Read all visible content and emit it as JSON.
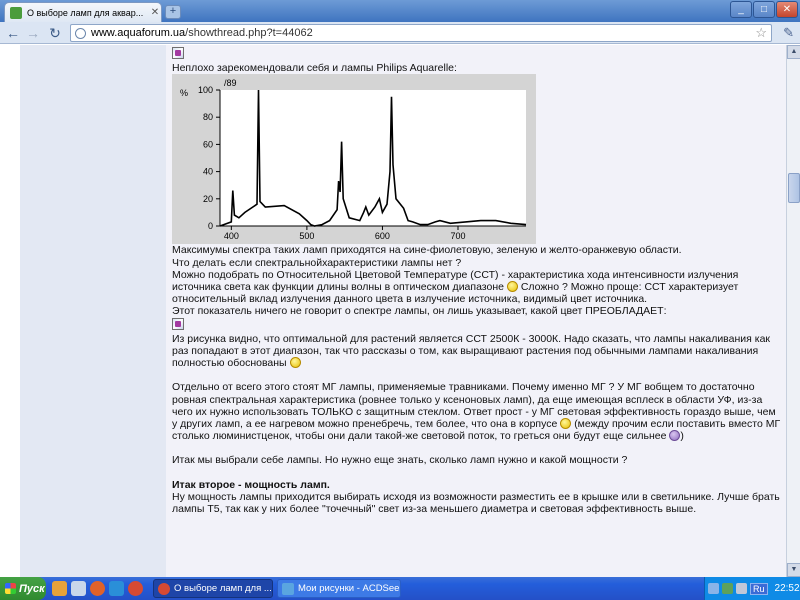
{
  "browser": {
    "tab_title": "О выборе ламп для аквар...",
    "url_domain": "www.aquaforum.ua",
    "url_path": "/showthread.php?t=44062"
  },
  "post": {
    "p1": "Неплохо зарекомендовали себя и лампы Philips Aquarelle:",
    "p2": "Максимумы спектра таких ламп приходятся на сине-фиолетовую, зеленую и желто-оранжевую области.",
    "p3": "Что делать если спектральнойхарактеристики лампы нет ?",
    "p4a": "Можно подобрать по Относительной Цветовой Температуре (ССТ) - характеристика хода интенсивности излучения источника света как функции длины волны в оптическом диапазоне",
    "p4b": "Сложно ? Можно проще: ССТ характеризует относительный вклад излучения данного цвета в излучение источника, видимый цвет источника.",
    "p5": "Этот показатель ничего не говорит о спектре лампы, он лишь указывает, какой цвет ПРЕОБЛАДАЕТ:",
    "p6": "Из рисунка видно, что оптимальной для растений является ССТ 2500К - 3000К. Надо сказать, что лампы накаливания как раз попадают в этот диапазон, так что рассказы о том, как выращивают растения под обычными лампами накаливания полностью обоснованы",
    "p7a": "Отдельно от всего этого стоят МГ лампы, применяемые травниками. Почему именно МГ ? У МГ вобщем то достаточно ровная спектральная характеристика (ровнее только у ксеноновых ламп), да еще имеющая всплеск в области УФ, из-за чего их нужно использовать ТОЛЬКО с защитным стеклом. Ответ прост - у МГ световая эффективность гораздо выше, чем у других ламп, а ее нагревом можно пренебречь, тем более, что она в корпусе",
    "p7b": "(между прочим если поставить вместо МГ столько люминистценок, чтобы они дали такой-же световой поток, то греться они будут еще сильнее",
    "p7c": ")",
    "p8": "Итак мы выбрали себе лампы. Но нужно еще знать, сколько ламп нужно и какой мощности ?",
    "h2": "Итак второе - мощность ламп.",
    "p9": "Ну мощность лампы приходится выбирать исходя из возможности разместить ее в крышке или в светильнике. Лучше брать лампы Т5, так как у них более \"точечный\" свет из-за меньшего диаметра и световая эффективность выше."
  },
  "chart_data": {
    "type": "line",
    "title": "/89",
    "ylabel": "%",
    "xlabel": "",
    "xlim": [
      385,
      790
    ],
    "ylim": [
      0,
      100
    ],
    "x_ticks": [
      400,
      500,
      600,
      700
    ],
    "y_ticks": [
      0,
      20,
      40,
      60,
      80,
      100
    ],
    "grid": false,
    "series": [
      {
        "values": [
          [
            385,
            0
          ],
          [
            400,
            3
          ],
          [
            402,
            26
          ],
          [
            404,
            8
          ],
          [
            410,
            6
          ],
          [
            418,
            10
          ],
          [
            434,
            16
          ],
          [
            436,
            100
          ],
          [
            438,
            18
          ],
          [
            445,
            14
          ],
          [
            470,
            15
          ],
          [
            490,
            9
          ],
          [
            500,
            4
          ],
          [
            505,
            1
          ],
          [
            510,
            0
          ],
          [
            520,
            1
          ],
          [
            530,
            4
          ],
          [
            540,
            12
          ],
          [
            542,
            33
          ],
          [
            544,
            25
          ],
          [
            546,
            62
          ],
          [
            548,
            20
          ],
          [
            556,
            6
          ],
          [
            570,
            4
          ],
          [
            575,
            10
          ],
          [
            578,
            14
          ],
          [
            582,
            8
          ],
          [
            590,
            14
          ],
          [
            596,
            20
          ],
          [
            600,
            10
          ],
          [
            606,
            16
          ],
          [
            610,
            40
          ],
          [
            612,
            95
          ],
          [
            614,
            45
          ],
          [
            618,
            20
          ],
          [
            628,
            13
          ],
          [
            634,
            4
          ],
          [
            640,
            3
          ],
          [
            650,
            1
          ],
          [
            660,
            1
          ],
          [
            670,
            3
          ],
          [
            676,
            4
          ],
          [
            690,
            2
          ],
          [
            710,
            3
          ],
          [
            730,
            4
          ],
          [
            750,
            4
          ],
          [
            770,
            2
          ],
          [
            790,
            1
          ]
        ]
      }
    ]
  },
  "taskbar": {
    "start": "Пуск",
    "task1": "О выборе ламп для ...",
    "task2": "Мои рисунки - ACDSee ...",
    "lang": "Ru",
    "clock": "22:52"
  }
}
